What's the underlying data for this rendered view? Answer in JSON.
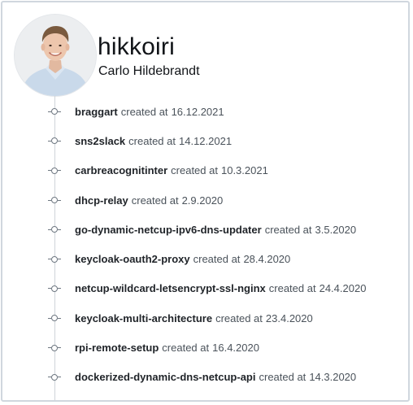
{
  "profile": {
    "username": "hikkoiri",
    "full_name": "Carlo Hildebrandt"
  },
  "created_prefix": "created at",
  "repos": [
    {
      "name": "braggart",
      "date": "16.12.2021"
    },
    {
      "name": "sns2slack",
      "date": "14.12.2021"
    },
    {
      "name": "carbreacognitinter",
      "date": "10.3.2021"
    },
    {
      "name": "dhcp-relay",
      "date": "2.9.2020"
    },
    {
      "name": "go-dynamic-netcup-ipv6-dns-updater",
      "date": "3.5.2020"
    },
    {
      "name": "keycloak-oauth2-proxy",
      "date": "28.4.2020"
    },
    {
      "name": "netcup-wildcard-letsencrypt-ssl-nginx",
      "date": "24.4.2020"
    },
    {
      "name": "keycloak-multi-architecture",
      "date": "23.4.2020"
    },
    {
      "name": "rpi-remote-setup",
      "date": "16.4.2020"
    },
    {
      "name": "dockerized-dynamic-dns-netcup-api",
      "date": "14.3.2020"
    }
  ]
}
